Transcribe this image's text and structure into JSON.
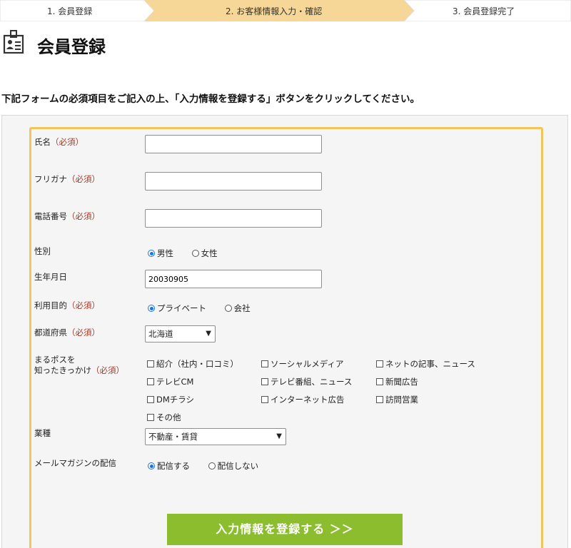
{
  "steps": [
    "1. 会員登録",
    "2. お客様情報入力・確認",
    "3. 会員登録完了"
  ],
  "page_title": "会員登録",
  "instructions": "下記フォームの必須項目をご記入の上、「入力情報を登録する」ボタンをクリックしてください。",
  "required_mark": "（必須）",
  "fields": {
    "name": {
      "label": "氏名",
      "value": ""
    },
    "furigana": {
      "label": "フリガナ",
      "value": ""
    },
    "phone": {
      "label": "電話番号",
      "value": ""
    },
    "gender": {
      "label": "性別",
      "options": [
        "男性",
        "女性"
      ],
      "selected": "男性"
    },
    "birthdate": {
      "label": "生年月日",
      "value": "20030905"
    },
    "purpose": {
      "label": "利用目的",
      "options": [
        "プライベート",
        "会社"
      ],
      "selected": "プライベート"
    },
    "prefecture": {
      "label": "都道府県",
      "value": "北海道"
    },
    "source": {
      "label_line1": "まるポスを",
      "label_line2": "知ったきっかけ",
      "options": [
        "紹介（社内・口コミ）",
        "ソーシャルメディア",
        "ネットの記事、ニュース",
        "テレビCM",
        "テレビ番組、ニュース",
        "新聞広告",
        "DMチラシ",
        "インターネット広告",
        "訪問営業",
        "その他"
      ]
    },
    "industry": {
      "label": "業種",
      "value": "不動産・賃貸"
    },
    "newsletter": {
      "label": "メールマガジンの配信",
      "options": [
        "配信する",
        "配信しない"
      ],
      "selected": "配信する"
    }
  },
  "submit_label": "入力情報を登録する ＞＞",
  "colors": {
    "step_active": "#f6d797",
    "frame": "#f2c45c",
    "submit": "#8cbd2e",
    "required": "#a23a2a"
  }
}
